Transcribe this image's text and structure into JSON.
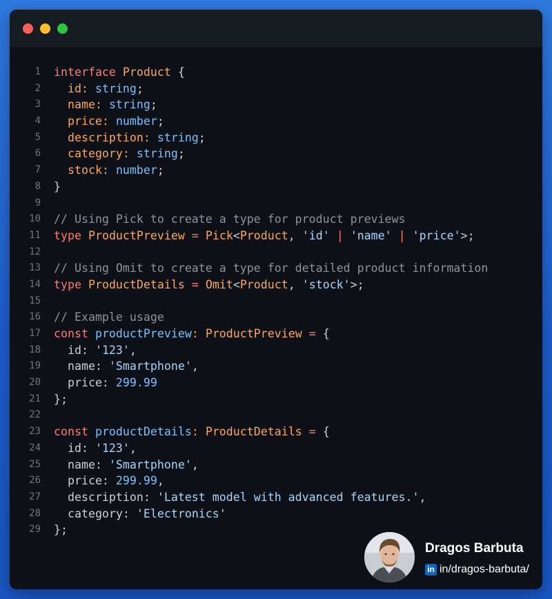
{
  "window": {
    "controls": [
      "close",
      "minimize",
      "maximize"
    ]
  },
  "code": {
    "lines": [
      [
        [
          "keyword",
          "interface"
        ],
        [
          "plain",
          " "
        ],
        [
          "type",
          "Product"
        ],
        [
          "plain",
          " {"
        ]
      ],
      [
        [
          "plain",
          "  "
        ],
        [
          "prop",
          "id:"
        ],
        [
          "plain",
          " "
        ],
        [
          "builtin",
          "string"
        ],
        [
          "plain",
          ";"
        ]
      ],
      [
        [
          "plain",
          "  "
        ],
        [
          "prop",
          "name:"
        ],
        [
          "plain",
          " "
        ],
        [
          "builtin",
          "string"
        ],
        [
          "plain",
          ";"
        ]
      ],
      [
        [
          "plain",
          "  "
        ],
        [
          "prop",
          "price:"
        ],
        [
          "plain",
          " "
        ],
        [
          "builtin",
          "number"
        ],
        [
          "plain",
          ";"
        ]
      ],
      [
        [
          "plain",
          "  "
        ],
        [
          "prop",
          "description:"
        ],
        [
          "plain",
          " "
        ],
        [
          "builtin",
          "string"
        ],
        [
          "plain",
          ";"
        ]
      ],
      [
        [
          "plain",
          "  "
        ],
        [
          "prop",
          "category:"
        ],
        [
          "plain",
          " "
        ],
        [
          "builtin",
          "string"
        ],
        [
          "plain",
          ";"
        ]
      ],
      [
        [
          "plain",
          "  "
        ],
        [
          "prop",
          "stock:"
        ],
        [
          "plain",
          " "
        ],
        [
          "builtin",
          "number"
        ],
        [
          "plain",
          ";"
        ]
      ],
      [
        [
          "plain",
          "}"
        ]
      ],
      [],
      [
        [
          "comment",
          "// Using Pick to create a type for product previews"
        ]
      ],
      [
        [
          "keyword",
          "type"
        ],
        [
          "plain",
          " "
        ],
        [
          "type",
          "ProductPreview"
        ],
        [
          "plain",
          " "
        ],
        [
          "op",
          "="
        ],
        [
          "plain",
          " "
        ],
        [
          "type",
          "Pick"
        ],
        [
          "plain",
          "<"
        ],
        [
          "type",
          "Product"
        ],
        [
          "plain",
          ", "
        ],
        [
          "string",
          "'id'"
        ],
        [
          "plain",
          " "
        ],
        [
          "op",
          "|"
        ],
        [
          "plain",
          " "
        ],
        [
          "string",
          "'name'"
        ],
        [
          "plain",
          " "
        ],
        [
          "op",
          "|"
        ],
        [
          "plain",
          " "
        ],
        [
          "string",
          "'price'"
        ],
        [
          "plain",
          ">;"
        ]
      ],
      [],
      [
        [
          "comment",
          "// Using Omit to create a type for detailed product information"
        ]
      ],
      [
        [
          "keyword",
          "type"
        ],
        [
          "plain",
          " "
        ],
        [
          "type",
          "ProductDetails"
        ],
        [
          "plain",
          " "
        ],
        [
          "op",
          "="
        ],
        [
          "plain",
          " "
        ],
        [
          "type",
          "Omit"
        ],
        [
          "plain",
          "<"
        ],
        [
          "type",
          "Product"
        ],
        [
          "plain",
          ", "
        ],
        [
          "string",
          "'stock'"
        ],
        [
          "plain",
          ">;"
        ]
      ],
      [],
      [
        [
          "comment",
          "// Example usage"
        ]
      ],
      [
        [
          "keyword",
          "const"
        ],
        [
          "plain",
          " "
        ],
        [
          "var",
          "productPreview"
        ],
        [
          "prop",
          ":"
        ],
        [
          "plain",
          " "
        ],
        [
          "type",
          "ProductPreview"
        ],
        [
          "plain",
          " "
        ],
        [
          "op",
          "="
        ],
        [
          "plain",
          " {"
        ]
      ],
      [
        [
          "plain",
          "  id: "
        ],
        [
          "string",
          "'123'"
        ],
        [
          "plain",
          ","
        ]
      ],
      [
        [
          "plain",
          "  name: "
        ],
        [
          "string",
          "'Smartphone'"
        ],
        [
          "plain",
          ","
        ]
      ],
      [
        [
          "plain",
          "  price: "
        ],
        [
          "number",
          "299.99"
        ]
      ],
      [
        [
          "plain",
          "};"
        ]
      ],
      [],
      [
        [
          "keyword",
          "const"
        ],
        [
          "plain",
          " "
        ],
        [
          "var",
          "productDetails"
        ],
        [
          "prop",
          ":"
        ],
        [
          "plain",
          " "
        ],
        [
          "type",
          "ProductDetails"
        ],
        [
          "plain",
          " "
        ],
        [
          "op",
          "="
        ],
        [
          "plain",
          " {"
        ]
      ],
      [
        [
          "plain",
          "  id: "
        ],
        [
          "string",
          "'123'"
        ],
        [
          "plain",
          ","
        ]
      ],
      [
        [
          "plain",
          "  name: "
        ],
        [
          "string",
          "'Smartphone'"
        ],
        [
          "plain",
          ","
        ]
      ],
      [
        [
          "plain",
          "  price: "
        ],
        [
          "number",
          "299.99"
        ],
        [
          "plain",
          ","
        ]
      ],
      [
        [
          "plain",
          "  description: "
        ],
        [
          "string",
          "'Latest model with advanced features.'"
        ],
        [
          "plain",
          ","
        ]
      ],
      [
        [
          "plain",
          "  category: "
        ],
        [
          "string",
          "'Electronics'"
        ]
      ],
      [
        [
          "plain",
          "};"
        ]
      ]
    ]
  },
  "author": {
    "name": "Dragos Barbuta",
    "linkedin_icon": "in",
    "linkedin_handle": "in/dragos-barbuta/",
    "avatar": "profile-photo"
  },
  "colors": {
    "background": "#2f7ae0",
    "editor_bg": "#0d1117",
    "titlebar_bg": "#161b22",
    "keyword": "#ff7b72",
    "type": "#ffa657",
    "builtin": "#79c0ff",
    "string": "#a5d6ff",
    "comment": "#8b949e",
    "plain": "#c9d1d9",
    "line_number": "#6e7681",
    "linkedin": "#0a66c2"
  }
}
